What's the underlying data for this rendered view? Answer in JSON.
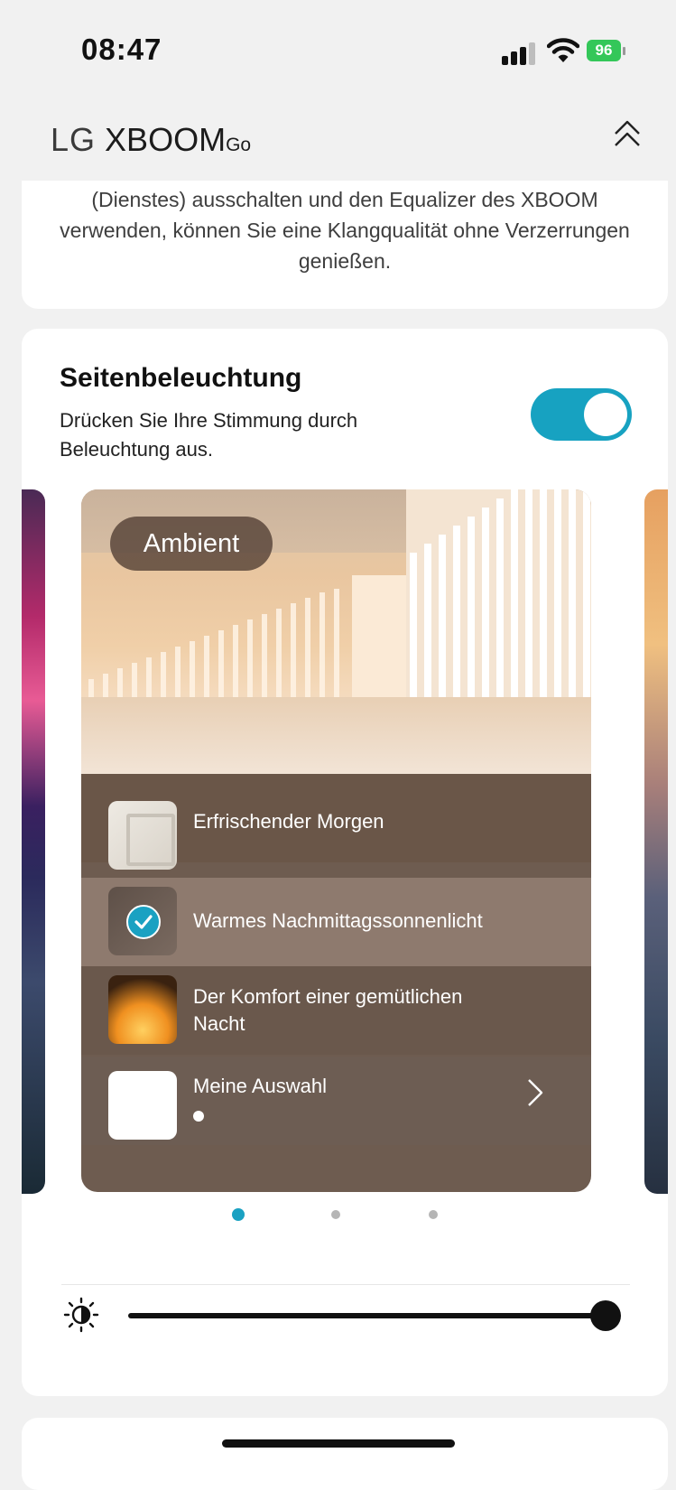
{
  "status_bar": {
    "time": "08:47",
    "battery": "96"
  },
  "header": {
    "brand_lg": "LG",
    "brand_name": "XBOOM",
    "brand_suffix": "Go"
  },
  "top_card": {
    "text": "(Dienstes) ausschalten und den Equalizer des XBOOM verwenden, können Sie eine Klangqualität ohne Verzerrungen genießen."
  },
  "lighting": {
    "title": "Seitenbeleuchtung",
    "subtitle": "Drücken Sie Ihre Stimmung durch Beleuchtung aus.",
    "toggle_on": true,
    "scene": {
      "tag": "Ambient",
      "options": [
        {
          "label": "Erfrischender Morgen",
          "selected": false
        },
        {
          "label": "Warmes Nachmittagssonnenlicht",
          "selected": true
        },
        {
          "label": "Der Komfort einer gemütlichen Nacht",
          "selected": false
        },
        {
          "label": "Meine Auswahl",
          "selected": false
        }
      ]
    },
    "pager": {
      "count": 3,
      "active": 1
    },
    "brightness_level": 1.0
  },
  "colors": {
    "accent": "#1aa1c2",
    "battery_green": "#34c759"
  }
}
